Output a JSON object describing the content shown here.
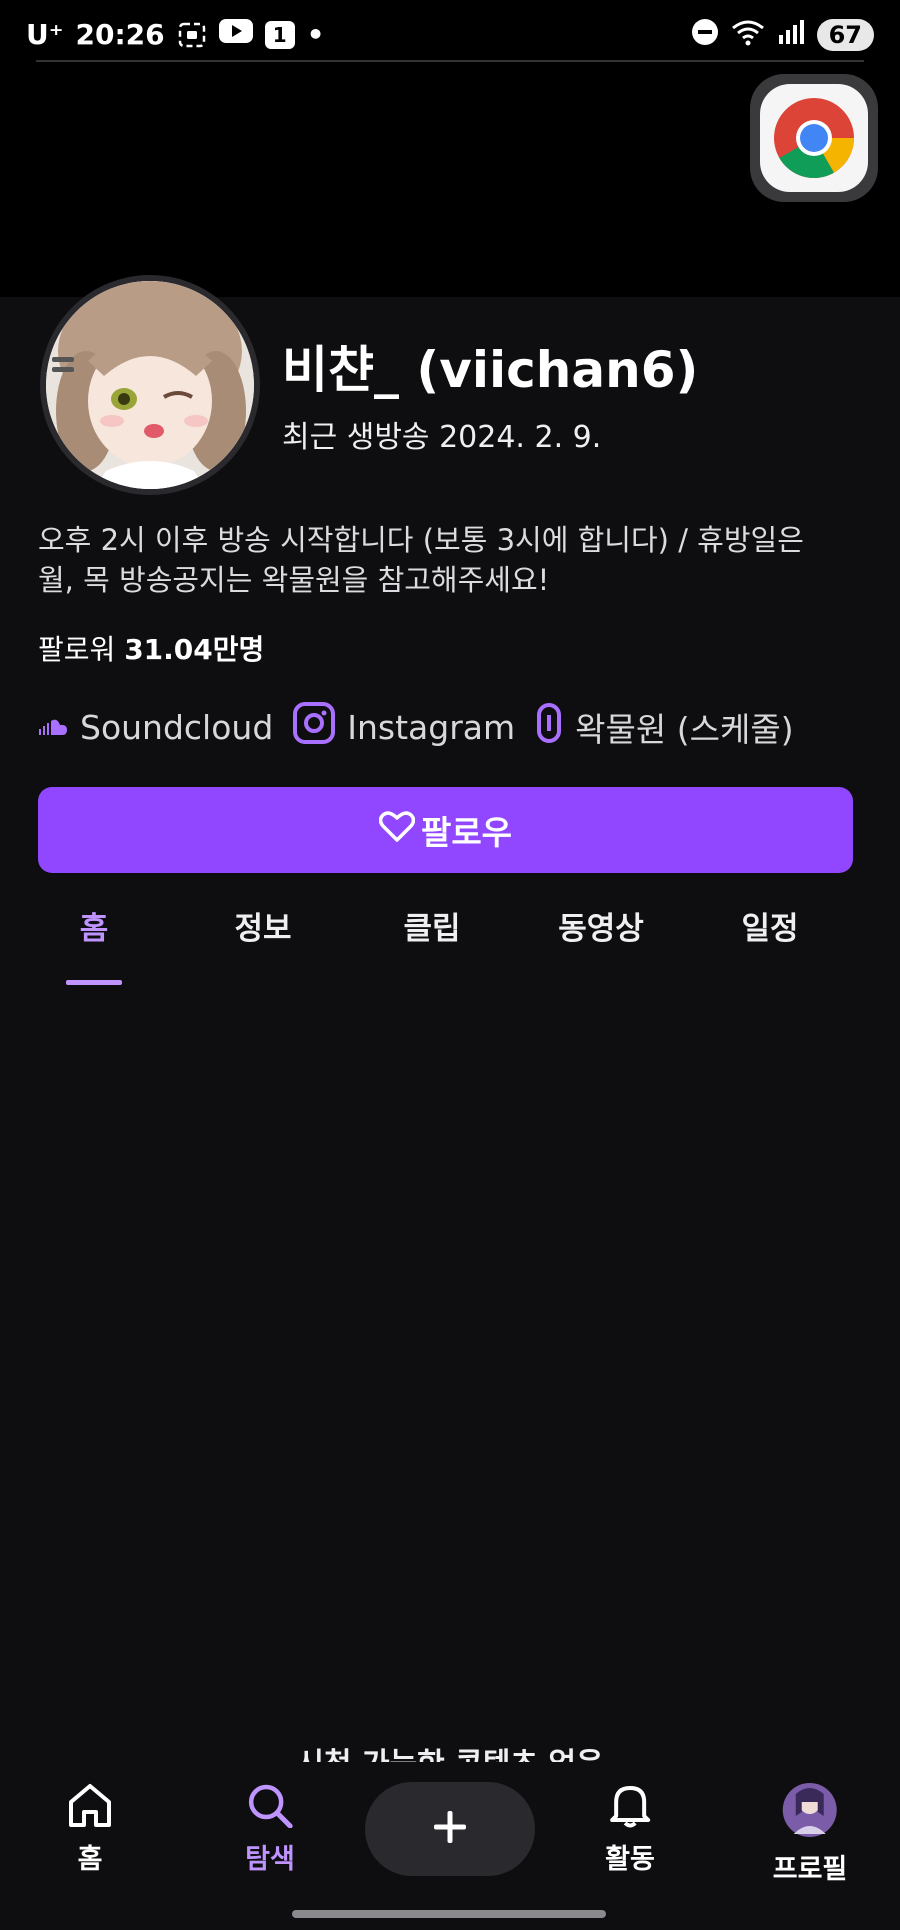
{
  "status_bar": {
    "carrier": "U⁺",
    "time": "20:26",
    "notification_count": "1",
    "signal_label": "5",
    "battery": "67"
  },
  "profile": {
    "channel_name": "비챤_ (viichan6)",
    "last_live": "최근 생방송 2024. 2. 9.",
    "description": "오후 2시 이후 방송 시작합니다 (보통 3시에 합니다) / 휴방일은 월, 목 방송공지는 왁물원을 참고해주세요!",
    "followers_label": "팔로워",
    "followers_count": "31.04만명"
  },
  "links": [
    {
      "label": "Soundcloud",
      "icon": "soundcloud-icon"
    },
    {
      "label": "Instagram",
      "icon": "instagram-icon"
    },
    {
      "label": "왁물원 (스케줄)",
      "icon": "link-icon"
    }
  ],
  "follow_button": {
    "label": "팔로우",
    "icon": "heart-icon"
  },
  "tabs": [
    {
      "label": "홈",
      "active": true
    },
    {
      "label": "정보",
      "active": false
    },
    {
      "label": "클립",
      "active": false
    },
    {
      "label": "동영상",
      "active": false
    },
    {
      "label": "일정",
      "active": false
    }
  ],
  "empty_state": "시청 가능한 콘텐츠 없음",
  "bottom_nav": [
    {
      "label": "홈",
      "icon": "home-icon",
      "active": false
    },
    {
      "label": "탐색",
      "icon": "search-icon",
      "active": true
    },
    {
      "label": "",
      "icon": "plus-icon",
      "active": false
    },
    {
      "label": "활동",
      "icon": "bell-icon",
      "active": false
    },
    {
      "label": "프로필",
      "icon": "profile-avatar",
      "active": false
    }
  ],
  "colors": {
    "accent": "#9147ff",
    "accent_light": "#bf94ff",
    "background": "#0e0e10"
  }
}
